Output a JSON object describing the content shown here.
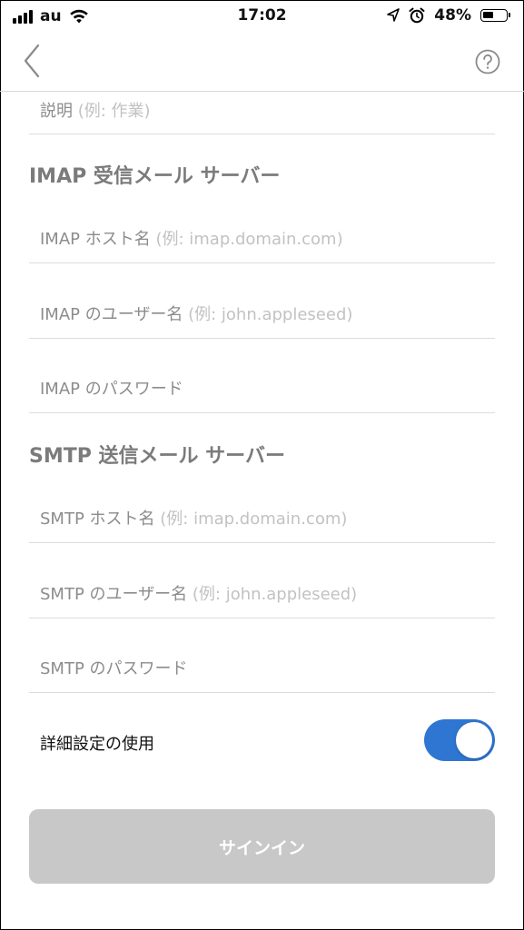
{
  "status_bar": {
    "carrier": "au",
    "time": "17:02",
    "battery_percent": "48%",
    "battery_level": 0.48,
    "icons": [
      "signal-icon",
      "wifi-icon",
      "location-arrow-icon",
      "alarm-icon",
      "battery-icon"
    ]
  },
  "nav": {
    "back_icon": "chevron-left-icon",
    "help_icon": "question-circle-icon"
  },
  "description_field": {
    "label": "説明",
    "placeholder": "(例: 作業)"
  },
  "imap": {
    "section_title": "IMAP 受信メール サーバー",
    "host": {
      "label": "IMAP ホスト名",
      "placeholder": "(例: imap.domain.com)"
    },
    "username": {
      "label": "IMAP のユーザー名",
      "placeholder": "(例: john.appleseed)"
    },
    "password": {
      "label": "IMAP のパスワード"
    }
  },
  "smtp": {
    "section_title": "SMTP 送信メール サーバー",
    "host": {
      "label": "SMTP ホスト名",
      "placeholder": "(例: imap.domain.com)"
    },
    "username": {
      "label": "SMTP のユーザー名",
      "placeholder": "(例: john.appleseed)"
    },
    "password": {
      "label": "SMTP のパスワード"
    }
  },
  "advanced": {
    "label": "詳細設定の使用",
    "enabled": true
  },
  "signin_button": {
    "label": "サインイン"
  },
  "colors": {
    "toggle_on": "#2f76d2",
    "button_disabled": "#c8c8c8",
    "section_title": "#7b7b7b"
  }
}
